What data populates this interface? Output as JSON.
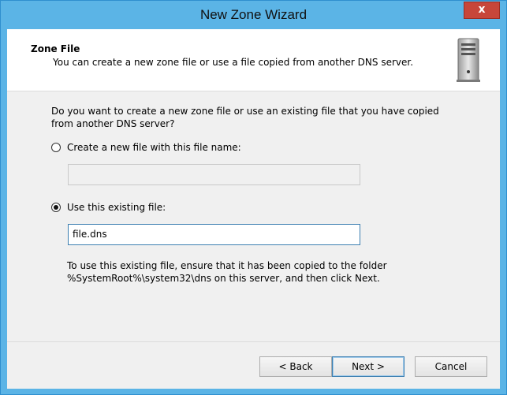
{
  "window": {
    "title": "New Zone Wizard",
    "close_glyph": "x"
  },
  "header": {
    "title": "Zone File",
    "subtitle": "You can create a new zone file or use a file copied from another DNS server.",
    "icon": "server-icon"
  },
  "body": {
    "question": "Do you want to create a new zone file or use an existing file that you have copied from another DNS server?",
    "option_new": {
      "label": "Create a new file with this file name:",
      "selected": false,
      "value": ""
    },
    "option_existing": {
      "label": "Use this existing file:",
      "selected": true,
      "value": "file.dns"
    },
    "info_line1": "To use this existing file, ensure that it has been copied to the folder",
    "info_line2": "%SystemRoot%\\system32\\dns on this server, and then click Next."
  },
  "buttons": {
    "back": "< Back",
    "next": "Next >",
    "cancel": "Cancel"
  }
}
